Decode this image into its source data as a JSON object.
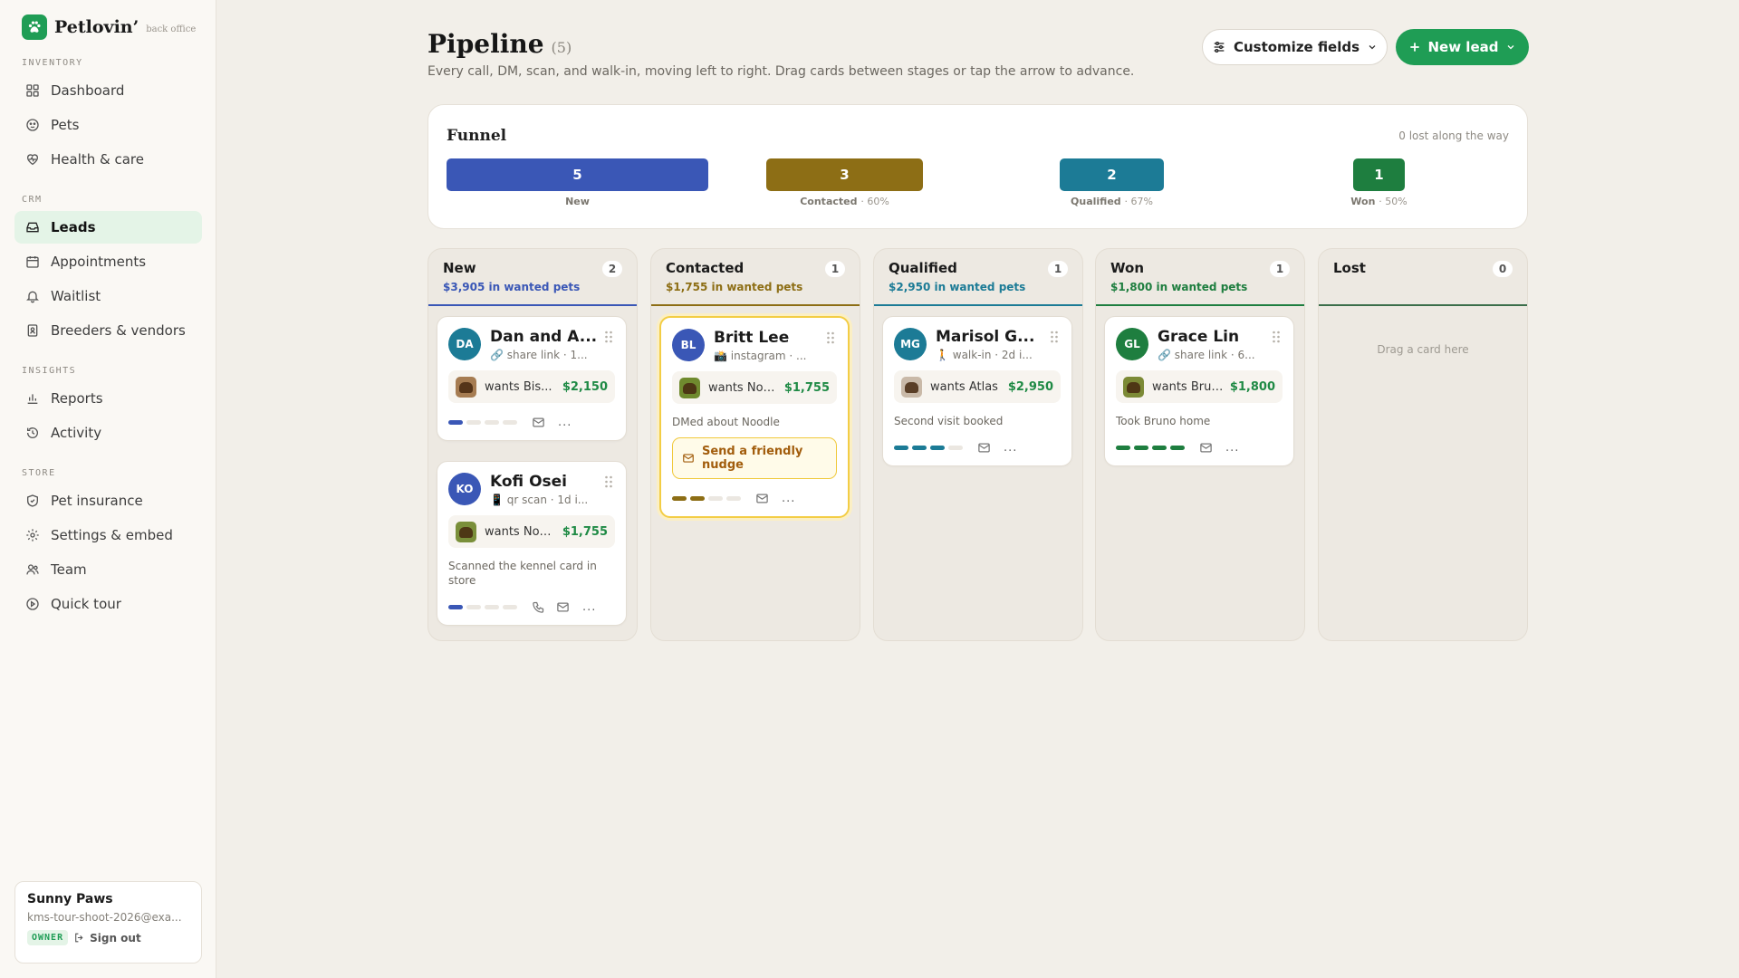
{
  "app": {
    "name": "Petlovin’",
    "sub": "back office"
  },
  "sidebar": {
    "sections": [
      {
        "label": "INVENTORY",
        "items": [
          {
            "label": "Dashboard",
            "icon": "grid-icon"
          },
          {
            "label": "Pets",
            "icon": "paw-icon"
          },
          {
            "label": "Health & care",
            "icon": "heart-pulse-icon"
          }
        ]
      },
      {
        "label": "CRM",
        "items": [
          {
            "label": "Leads",
            "icon": "inbox-icon",
            "active": true
          },
          {
            "label": "Appointments",
            "icon": "calendar-icon"
          },
          {
            "label": "Waitlist",
            "icon": "bell-icon"
          },
          {
            "label": "Breeders & vendors",
            "icon": "contact-book-icon"
          }
        ]
      },
      {
        "label": "INSIGHTS",
        "items": [
          {
            "label": "Reports",
            "icon": "bar-chart-icon"
          },
          {
            "label": "Activity",
            "icon": "history-icon"
          }
        ]
      },
      {
        "label": "STORE",
        "items": [
          {
            "label": "Pet insurance",
            "icon": "shield-icon"
          },
          {
            "label": "Settings & embed",
            "icon": "gear-icon"
          },
          {
            "label": "Team",
            "icon": "users-icon"
          },
          {
            "label": "Quick tour",
            "icon": "play-circle-icon"
          }
        ]
      }
    ],
    "account": {
      "name": "Sunny Paws",
      "email": "kms-tour-shoot-2026@exa...",
      "role": "OWNER",
      "signout": "Sign out"
    }
  },
  "header": {
    "title": "Pipeline",
    "count": "(5)",
    "subtitle": "Every call, DM, scan, and walk-in, moving left to right. Drag cards between stages or tap the arrow to advance.",
    "customize_label": "Customize fields",
    "new_lead_label": "New lead"
  },
  "funnel": {
    "title": "Funnel",
    "lost_note": "0 lost along the way",
    "stages": [
      {
        "label": "New",
        "value": "5",
        "pct": "",
        "color": "#3a57b6"
      },
      {
        "label": "Contacted",
        "value": "3",
        "pct": "· 60%",
        "color": "#8d6e15"
      },
      {
        "label": "Qualified",
        "value": "2",
        "pct": "· 67%",
        "color": "#1c7b96"
      },
      {
        "label": "Won",
        "value": "1",
        "pct": "· 50%",
        "color": "#1e7e3f"
      }
    ]
  },
  "columns": [
    {
      "title": "New",
      "count": "2",
      "sub": "$3,905 in wanted pets",
      "color": "#3a57b6",
      "drop": "",
      "cards": [
        {
          "initials": "DA",
          "name": "Dan and A...",
          "meta": "🔗 share link · 1...",
          "avatar_color": "#1c7b96",
          "want": "wants Bis...",
          "price": "$2,150",
          "note": "",
          "nudge": "",
          "progress": 1,
          "icons": [
            "mail-icon"
          ]
        },
        {
          "initials": "KO",
          "name": "Kofi Osei",
          "meta": "📱 qr scan · 1d i...",
          "avatar_color": "#3a57b6",
          "want": "wants Noo...",
          "price": "$1,755",
          "note": "Scanned the kennel card in store",
          "nudge": "",
          "progress": 1,
          "icons": [
            "phone-icon",
            "mail-icon"
          ]
        }
      ]
    },
    {
      "title": "Contacted",
      "count": "1",
      "sub": "$1,755 in wanted pets",
      "color": "#8d6e15",
      "drop": "",
      "cards": [
        {
          "initials": "BL",
          "name": "Britt Lee",
          "meta": "📸 instagram · ...",
          "avatar_color": "#3a57b6",
          "want": "wants Noo...",
          "price": "$1,755",
          "note": "DMed about Noodle",
          "nudge": "Send a friendly nudge",
          "progress": 2,
          "icons": [
            "mail-icon"
          ],
          "highlight": true
        }
      ]
    },
    {
      "title": "Qualified",
      "count": "1",
      "sub": "$2,950 in wanted pets",
      "color": "#1c7b96",
      "drop": "",
      "cards": [
        {
          "initials": "MG",
          "name": "Marisol G...",
          "meta": "🚶 walk-in · 2d i...",
          "avatar_color": "#1c7b96",
          "want": "wants Atlas",
          "price": "$2,950",
          "note": "Second visit booked",
          "nudge": "",
          "progress": 3,
          "icons": [
            "mail-icon"
          ]
        }
      ]
    },
    {
      "title": "Won",
      "count": "1",
      "sub": "$1,800 in wanted pets",
      "color": "#1e7e3f",
      "drop": "",
      "cards": [
        {
          "initials": "GL",
          "name": "Grace Lin",
          "meta": "🔗 share link · 6...",
          "avatar_color": "#1e7e3f",
          "want": "wants Bruno",
          "price": "$1,800",
          "note": "Took Bruno home",
          "nudge": "",
          "progress": 4,
          "icons": [
            "mail-icon"
          ]
        }
      ]
    },
    {
      "title": "Lost",
      "count": "0",
      "sub": "",
      "color": "#3b6e4a",
      "drop": "Drag a card here",
      "cards": []
    }
  ]
}
